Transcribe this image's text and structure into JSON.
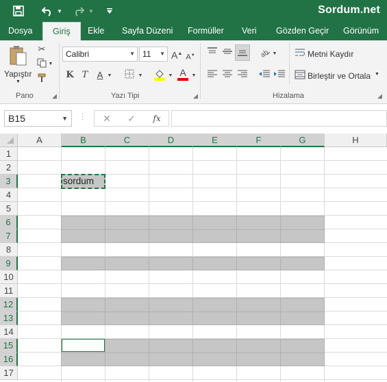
{
  "watermark": "Sordum.net",
  "quick_access": {
    "save_icon": "save-icon",
    "undo_icon": "undo-icon",
    "redo_icon": "redo-icon",
    "customize_icon": "customize-quick-access-icon"
  },
  "tabs": [
    "Dosya",
    "Giriş",
    "Ekle",
    "Sayfa Düzeni",
    "Formüller",
    "Veri",
    "Gözden Geçir",
    "Görünüm"
  ],
  "active_tab": "Giriş",
  "ribbon": {
    "clipboard": {
      "paste_label": "Yapıştır",
      "group_label": "Pano"
    },
    "font": {
      "font_name": "Calibri",
      "font_size": "11",
      "bold": "K",
      "italic": "T",
      "underline": "A",
      "font_color_letter": "A",
      "grow": "A",
      "shrink": "A",
      "group_label": "Yazı Tipi",
      "fill_color": "#ffff00",
      "text_color": "#e00000"
    },
    "alignment": {
      "wrap_text": "Metni Kaydır",
      "merge_center": "Birleştir ve Ortala",
      "group_label": "Hizalama"
    }
  },
  "formula_bar": {
    "name_box": "B15",
    "cancel": "✕",
    "enter": "✓",
    "function": "fx",
    "value": ""
  },
  "sheet": {
    "columns": [
      "A",
      "B",
      "C",
      "D",
      "E",
      "F",
      "G",
      "H"
    ],
    "rows": [
      "1",
      "2",
      "3",
      "4",
      "5",
      "6",
      "7",
      "8",
      "9",
      "10",
      "11",
      "12",
      "13",
      "14",
      "15",
      "16",
      "17"
    ],
    "selected_columns": [
      "B",
      "C",
      "D",
      "E",
      "F",
      "G"
    ],
    "selected_rows": [
      "3",
      "6",
      "7",
      "9",
      "12",
      "13",
      "15",
      "16"
    ],
    "active_cell": "B15",
    "copied_cell": {
      "ref": "B3",
      "text": "sordum"
    },
    "fill_color": "#c6c6c6",
    "accent": "#217346"
  }
}
